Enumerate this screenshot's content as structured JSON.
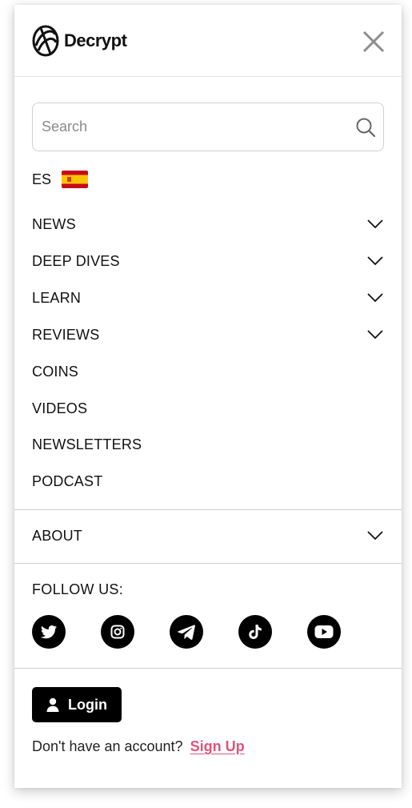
{
  "brand": {
    "name": "Decrypt"
  },
  "search": {
    "placeholder": "Search"
  },
  "language": {
    "code": "ES",
    "flag_icon": "spain-flag-icon"
  },
  "nav": {
    "items": [
      {
        "label": "NEWS",
        "expandable": true
      },
      {
        "label": "DEEP DIVES",
        "expandable": true
      },
      {
        "label": "LEARN",
        "expandable": true
      },
      {
        "label": "REVIEWS",
        "expandable": true
      },
      {
        "label": "COINS",
        "expandable": false
      },
      {
        "label": "VIDEOS",
        "expandable": false
      },
      {
        "label": "NEWSLETTERS",
        "expandable": false
      },
      {
        "label": "PODCAST",
        "expandable": false
      }
    ],
    "about": {
      "label": "ABOUT",
      "expandable": true
    }
  },
  "follow": {
    "label": "FOLLOW US:",
    "socials": [
      "twitter-icon",
      "instagram-icon",
      "telegram-icon",
      "tiktok-icon",
      "youtube-icon"
    ]
  },
  "account": {
    "login_label": "Login",
    "signup_prompt": "Don't have an account?",
    "signup_label": "Sign Up"
  },
  "colors": {
    "accent": "#e0527a",
    "button": "#000000",
    "text": "#111111"
  }
}
